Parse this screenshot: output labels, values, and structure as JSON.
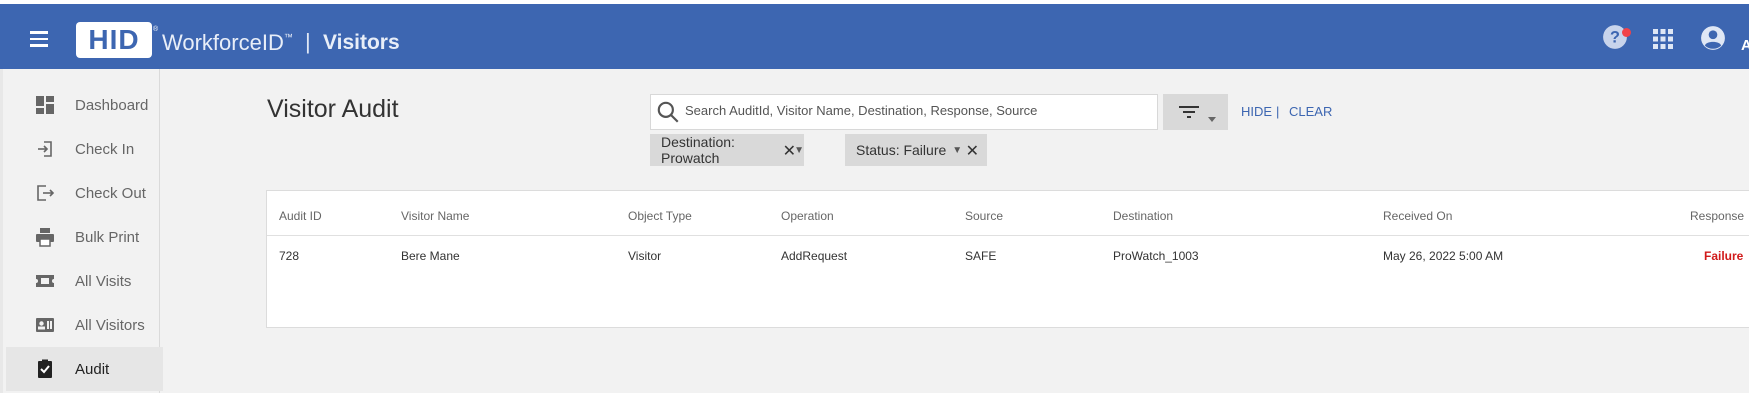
{
  "header": {
    "logo_text": "HID",
    "logo_tm": "®",
    "product_name": "WorkforceID",
    "product_tm": "™",
    "separator": "|",
    "app_name": "Visitors",
    "user_initial": "A"
  },
  "sidebar": {
    "items": [
      {
        "label": "Dashboard",
        "icon": "dashboard-icon"
      },
      {
        "label": "Check In",
        "icon": "check-in-icon"
      },
      {
        "label": "Check Out",
        "icon": "check-out-icon"
      },
      {
        "label": "Bulk Print",
        "icon": "printer-icon"
      },
      {
        "label": "All Visits",
        "icon": "ticket-icon"
      },
      {
        "label": "All Visitors",
        "icon": "id-card-icon"
      },
      {
        "label": "Audit",
        "icon": "clipboard-check-icon"
      }
    ]
  },
  "main": {
    "title": "Visitor Audit",
    "search": {
      "placeholder": "Search AuditId, Visitor Name, Destination, Response, Source"
    },
    "hide_label": "HIDE",
    "pipe": "|",
    "clear_label": "CLEAR",
    "chips": [
      {
        "label": "Destination: Prowatch"
      },
      {
        "label": "Status: Failure"
      }
    ],
    "table": {
      "columns": [
        "Audit ID",
        "Visitor Name",
        "Object Type",
        "Operation",
        "Source",
        "Destination",
        "Received On",
        "Response"
      ],
      "rows": [
        [
          "728",
          "Bere Mane",
          "Visitor",
          "AddRequest",
          "SAFE",
          "ProWatch_1003",
          "May 26, 2022 5:00 AM",
          "Failure"
        ]
      ]
    }
  },
  "colors": {
    "header_bg": "#3d66b1",
    "link": "#3d66b1",
    "failure": "#d11a1a",
    "notification_dot": "#f0424a"
  }
}
